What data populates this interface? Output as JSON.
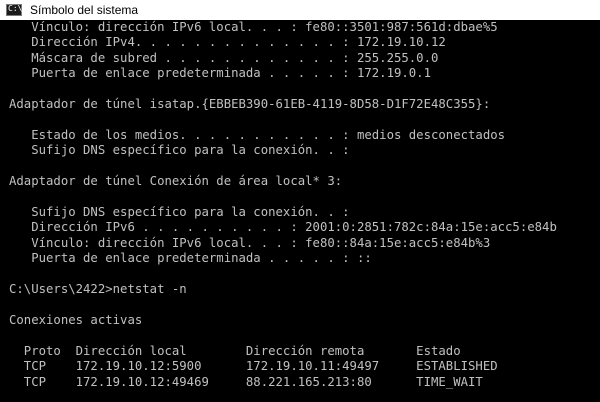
{
  "window": {
    "title": "Símbolo del sistema",
    "icon": "cmd-icon",
    "icon_glyph": "C:\\"
  },
  "colors": {
    "console_background": "#000000",
    "console_text": "#c0c0c0",
    "titlebar_background": "#ffffff"
  },
  "console": {
    "lines": [
      "   Vínculo: dirección IPv6 local. . . : fe80::3501:987:561d:dbae%5",
      "   Dirección IPv4. . . . . . . . . . . . . . : 172.19.10.12",
      "   Máscara de subred . . . . . . . . . . . . : 255.255.0.0",
      "   Puerta de enlace predeterminada . . . . . : 172.19.0.1",
      "",
      "Adaptador de túnel isatap.{EBBEB390-61EB-4119-8D58-D1F72E48C355}:",
      "",
      "   Estado de los medios. . . . . . . . . . . : medios desconectados",
      "   Sufijo DNS específico para la conexión. . :",
      "",
      "Adaptador de túnel Conexión de área local* 3:",
      "",
      "   Sufijo DNS específico para la conexión. . :",
      "   Dirección IPv6 . . . . . . . . . . : 2001:0:2851:782c:84a:15e:acc5:e84b",
      "   Vínculo: dirección IPv6 local. . . : fe80::84a:15e:acc5:e84b%3",
      "   Puerta de enlace predeterminada . . . . . : ::",
      "",
      "C:\\Users\\2422>netstat -n",
      "",
      "Conexiones activas",
      "",
      "  Proto  Dirección local        Dirección remota       Estado",
      "  TCP    172.19.10.12:5900      172.19.10.11:49497     ESTABLISHED",
      "  TCP    172.19.10.12:49469     88.221.165.213:80      TIME_WAIT"
    ]
  }
}
